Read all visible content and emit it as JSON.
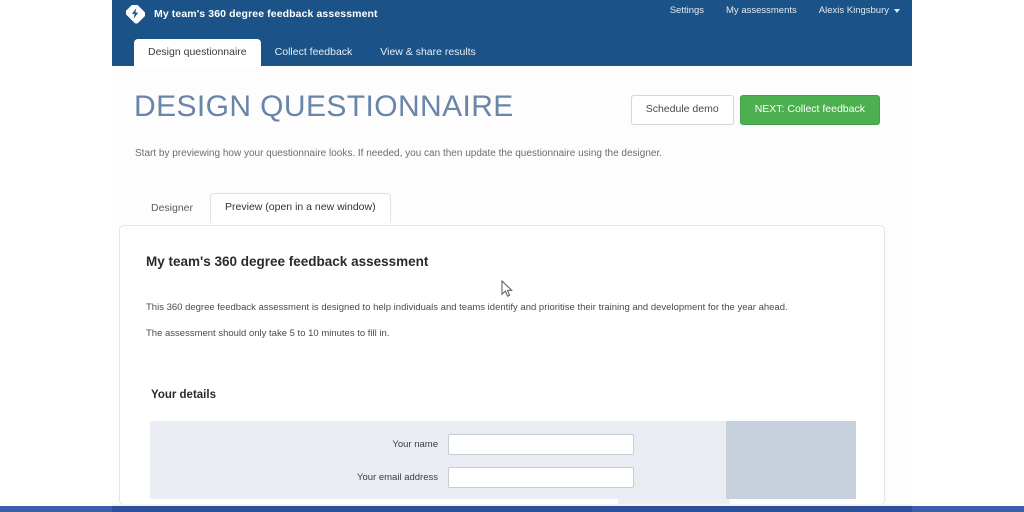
{
  "app": {
    "brand_title": "My team's 360 degree feedback assessment",
    "logo_icon": "lightning-bolt-badge-icon"
  },
  "topnav": {
    "items": [
      {
        "label": "Settings",
        "name": "settings"
      },
      {
        "label": "My assessments",
        "name": "my-assessments"
      }
    ],
    "user": {
      "label": "Alexis Kingsbury",
      "caret_icon": "chevron-down-icon"
    }
  },
  "mainnav": {
    "tabs": [
      {
        "label": "Design questionnaire",
        "active": true
      },
      {
        "label": "Collect feedback",
        "active": false
      },
      {
        "label": "View & share results",
        "active": false
      }
    ]
  },
  "page": {
    "title": "DESIGN QUESTIONNAIRE",
    "subtitle": "Start by previewing how your questionnaire looks. If needed, you can then update the questionnaire using the designer."
  },
  "actions": {
    "schedule_demo_label": "Schedule demo",
    "next_label": "NEXT: Collect feedback"
  },
  "subtabs": {
    "designer_label": "Designer",
    "preview_label": "Preview (open in a new window)"
  },
  "preview": {
    "heading": "My team's 360 degree feedback assessment",
    "paragraph_1": "This 360 degree feedback assessment is designed to help individuals and teams identify and prioritise their training and development for the year ahead.",
    "paragraph_2": "The assessment should only take 5 to 10 minutes to fill in.",
    "section_heading": "Your details",
    "fields": [
      {
        "label": "Your name",
        "value": "",
        "placeholder": ""
      },
      {
        "label": "Your email address",
        "value": "",
        "placeholder": ""
      }
    ]
  },
  "colors": {
    "header_blue": "#1b5287",
    "title_slate": "#6985a8",
    "primary_green": "#4caf50",
    "form_panel": "#e9ecf2",
    "form_accent": "#c7d0dd",
    "bottom_bar": "#2b4f9a"
  }
}
